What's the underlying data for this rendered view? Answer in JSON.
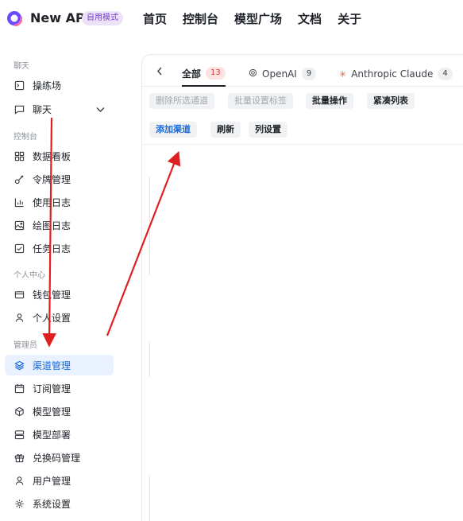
{
  "header": {
    "title": "New API",
    "mode_badge": "自用模式",
    "nav": [
      "首页",
      "控制台",
      "模型广场",
      "文档",
      "关于"
    ]
  },
  "sidebar": {
    "sections": [
      "聊天",
      "控制台",
      "个人中心",
      "管理员"
    ],
    "items": [
      {
        "label": "操练场",
        "icon": "playground-icon"
      },
      {
        "label": "聊天",
        "icon": "chat-icon"
      },
      {
        "label": "数据看板",
        "icon": "dashboard-icon"
      },
      {
        "label": "令牌管理",
        "icon": "key-icon"
      },
      {
        "label": "使用日志",
        "icon": "bar-chart-icon"
      },
      {
        "label": "绘图日志",
        "icon": "image-icon"
      },
      {
        "label": "任务日志",
        "icon": "checkbox-icon"
      },
      {
        "label": "钱包管理",
        "icon": "wallet-icon"
      },
      {
        "label": "个人设置",
        "icon": "user-icon"
      },
      {
        "label": "渠道管理",
        "icon": "layers-icon"
      },
      {
        "label": "订阅管理",
        "icon": "calendar-icon"
      },
      {
        "label": "模型管理",
        "icon": "cube-icon"
      },
      {
        "label": "模型部署",
        "icon": "server-icon"
      },
      {
        "label": "兑换码管理",
        "icon": "gift-icon"
      },
      {
        "label": "用户管理",
        "icon": "user-icon"
      },
      {
        "label": "系统设置",
        "icon": "gear-icon"
      }
    ],
    "active": "渠道管理"
  },
  "tabs": [
    {
      "label": "全部",
      "count": "13"
    },
    {
      "label": "OpenAI",
      "count": "9"
    },
    {
      "label": "Anthropic Claude",
      "count": "4"
    }
  ],
  "toolbar": {
    "delete_selected": "删除所选通道",
    "batch_tag": "批量设置标签",
    "batch_ops": "批量操作",
    "compact_list": "紧凑列表",
    "add_channel": "添加渠道",
    "refresh": "刷新",
    "column_settings": "列设置"
  },
  "colors": {
    "accent": "#1a6bd8",
    "arrow": "#e02020",
    "badge_bg": "#ece3f8"
  }
}
